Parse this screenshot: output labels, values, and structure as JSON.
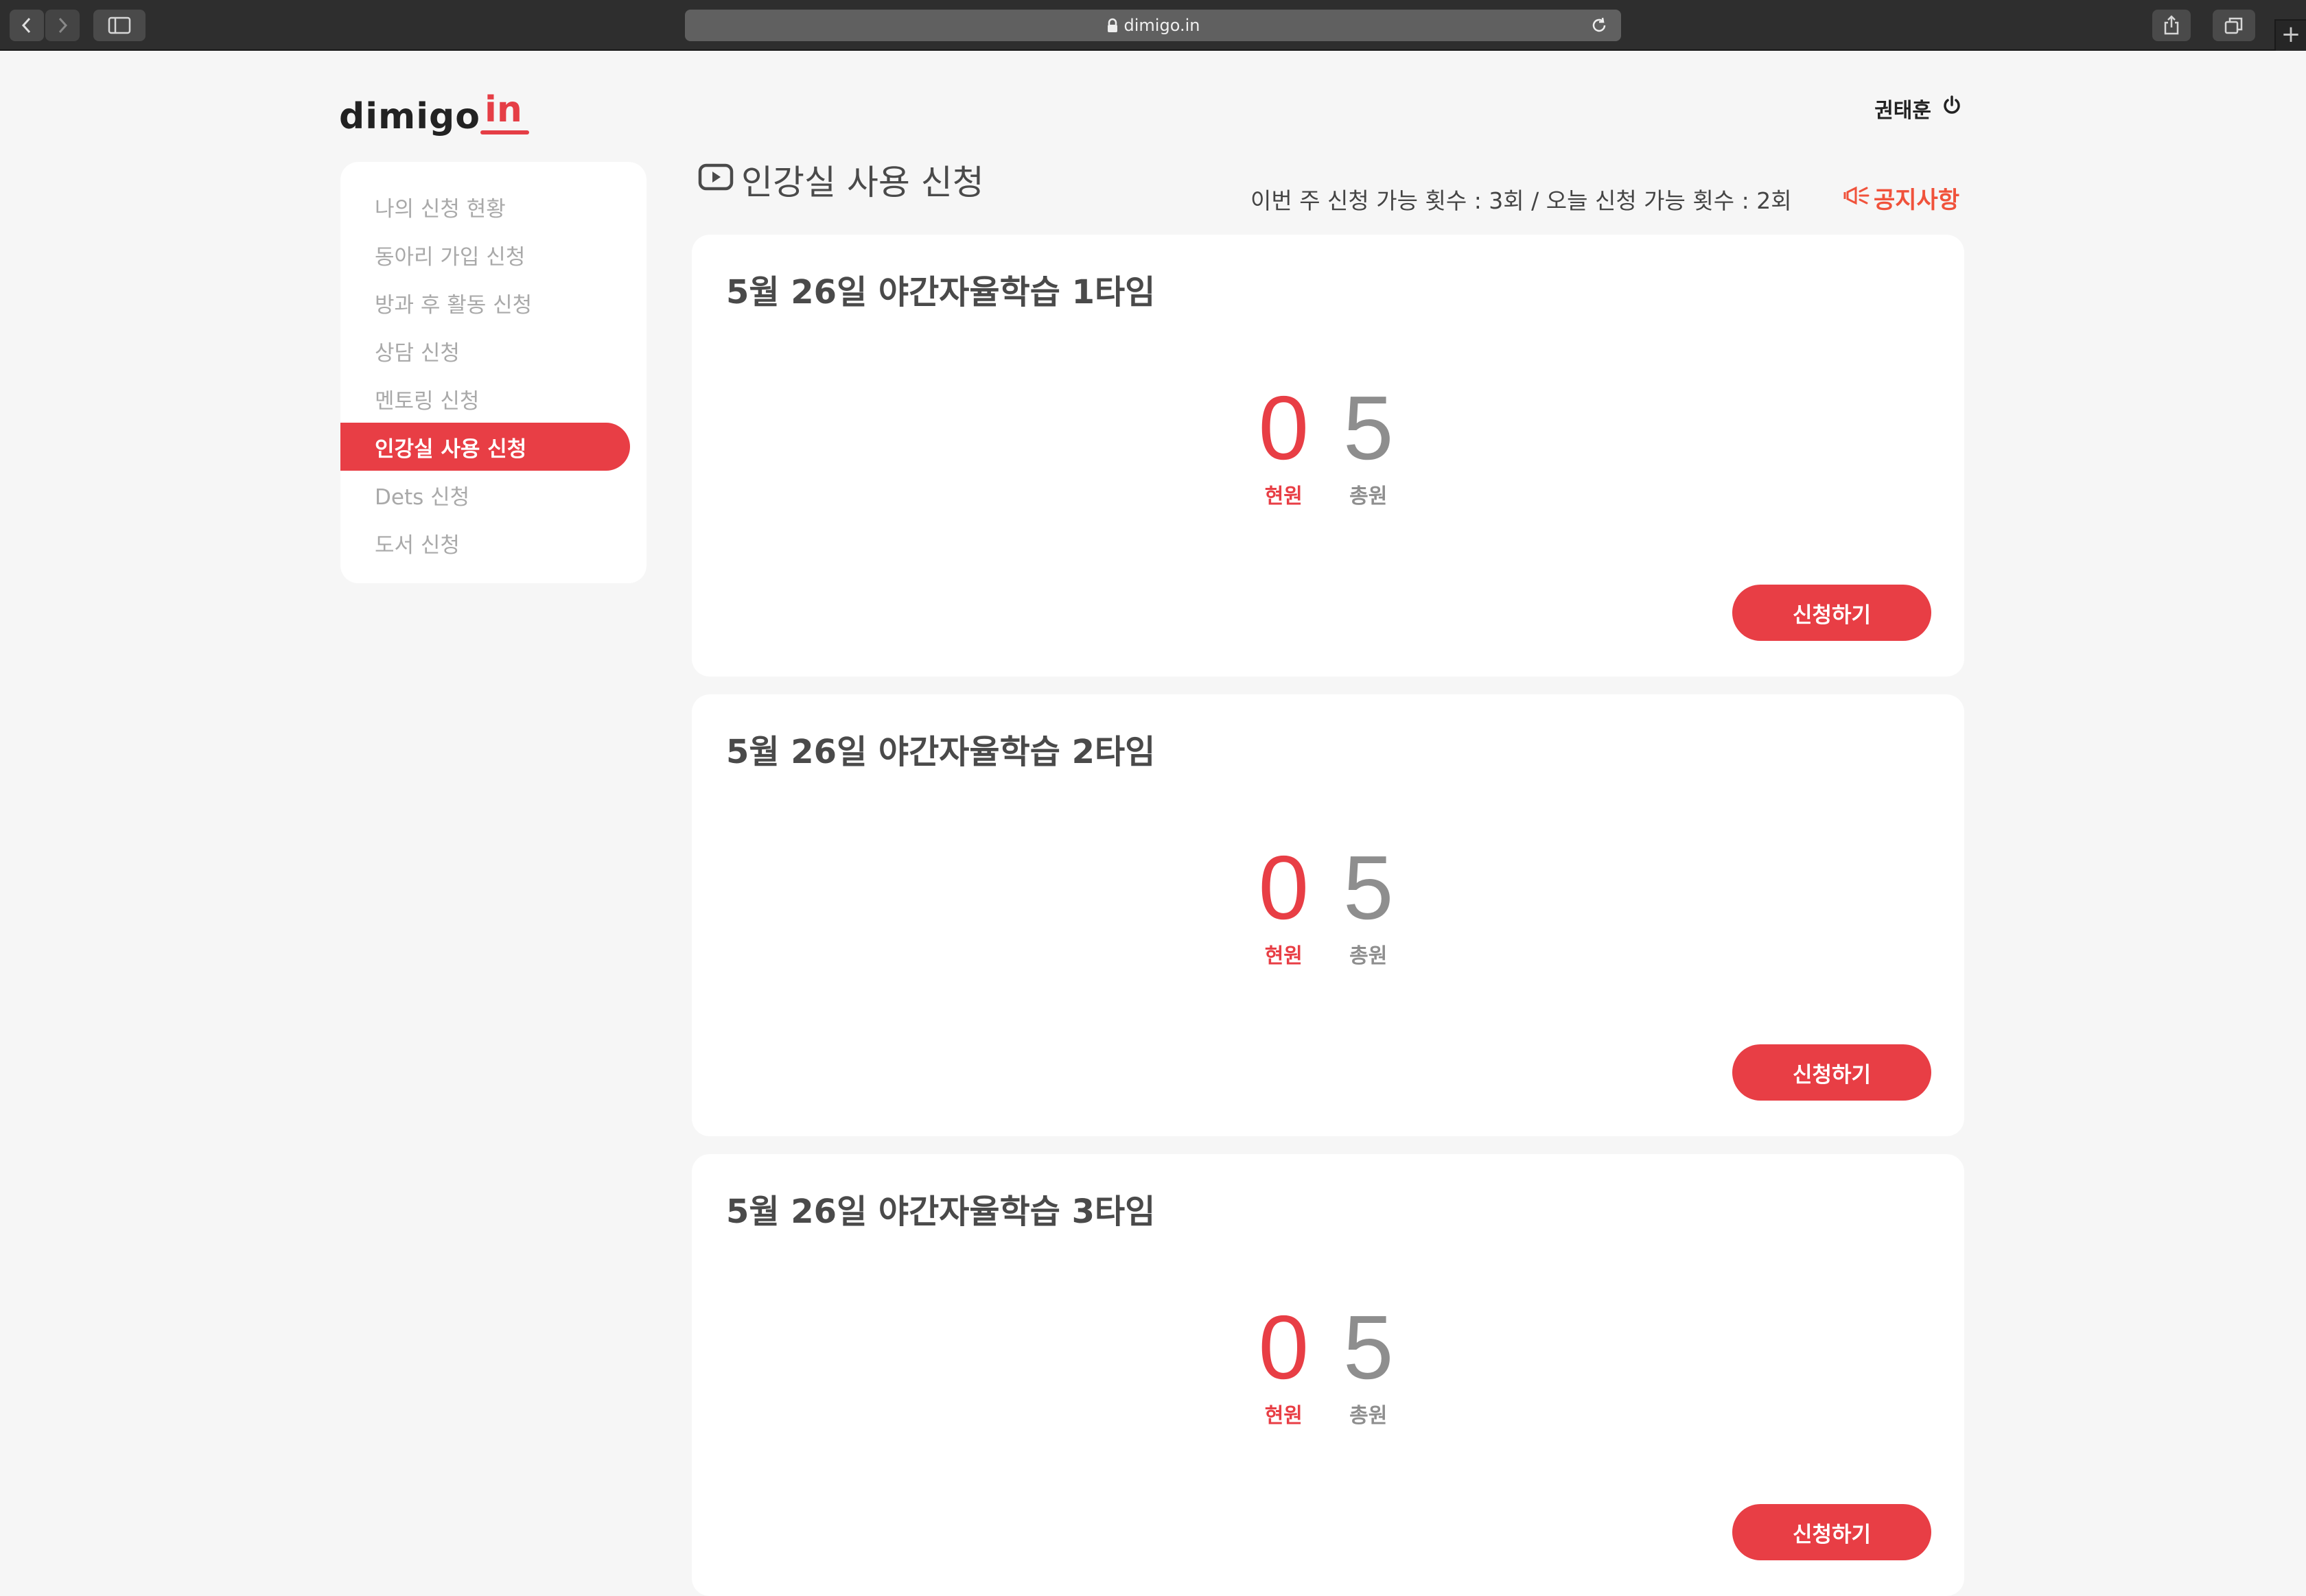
{
  "browser": {
    "url": "dimigo.in",
    "new_tab_symbol": "+"
  },
  "header": {
    "logo_main": "dimigo",
    "logo_accent": "in",
    "user_name": "권태훈"
  },
  "sidebar": {
    "items": [
      {
        "label": "나의 신청 현황"
      },
      {
        "label": "동아리 가입 신청"
      },
      {
        "label": "방과 후 활동 신청"
      },
      {
        "label": "상담 신청"
      },
      {
        "label": "멘토링 신청"
      },
      {
        "label": "인강실 사용 신청"
      },
      {
        "label": "Dets 신청"
      },
      {
        "label": "도서 신청"
      }
    ],
    "active_index": 5
  },
  "main": {
    "title": "인강실 사용 신청",
    "quota_text": "이번 주 신청 가능 횟수 : 3회 / 오늘 신청 가능 횟수 : 2회",
    "notice_label": "공지사항"
  },
  "cards": [
    {
      "title": "5월 26일 야간자율학습 1타임",
      "current": "0",
      "current_label": "현원",
      "total": "5",
      "total_label": "총원",
      "button": "신청하기"
    },
    {
      "title": "5월 26일 야간자율학습 2타임",
      "current": "0",
      "current_label": "현원",
      "total": "5",
      "total_label": "총원",
      "button": "신청하기"
    },
    {
      "title": "5월 26일 야간자율학습 3타임",
      "current": "0",
      "current_label": "현원",
      "total": "5",
      "total_label": "총원",
      "button": "신청하기"
    }
  ],
  "colors": {
    "accent": "#e83e45",
    "notice": "#f0523b",
    "muted": "#8e8e8e",
    "background": "#f6f6f6"
  },
  "icons": {
    "back": "chevron-left-icon",
    "forward": "chevron-right-icon",
    "sidebar_toggle": "sidebar-icon",
    "lock": "lock-icon",
    "reload": "reload-icon",
    "share": "share-icon",
    "tabs": "tabs-icon",
    "power": "power-icon",
    "title": "play-icon",
    "notice": "megaphone-icon"
  }
}
